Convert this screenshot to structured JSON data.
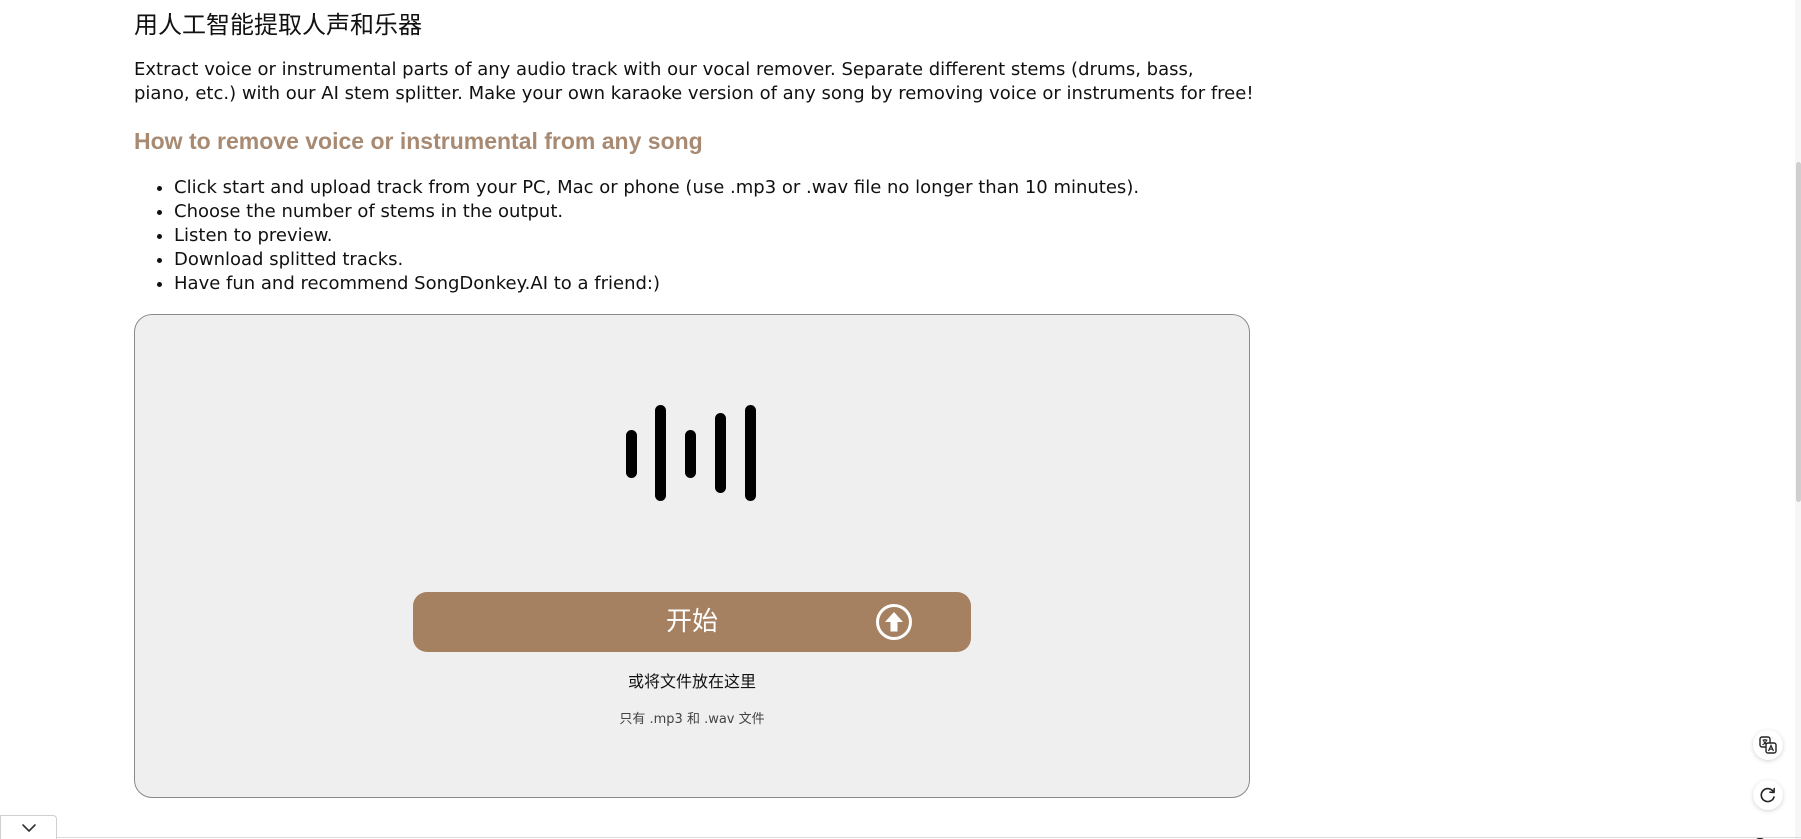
{
  "page": {
    "title": "用人工智能提取人声和乐器",
    "intro": "Extract voice or instrumental parts of any audio track with our vocal remover. Separate different stems (drums, bass, piano, etc.) with our AI stem splitter. Make your own karaoke version of any song by removing voice or instruments for free!",
    "how_to_heading": "How to remove voice or instrumental from any song",
    "steps": [
      "Click start and upload track from your PC, Mac or phone (use .mp3 or .wav file no longer than 10 minutes).",
      "Choose the number of stems in the output.",
      "Listen to preview.",
      "Download splitted tracks.",
      "Have fun and recommend SongDonkey.AI to a friend:)"
    ]
  },
  "uploader": {
    "icon": "audio-waveform-icon",
    "start_label": "开始",
    "start_icon": "upload-arrow-icon",
    "drop_hint": "或将文件放在这里",
    "format_hint": "只有 .mp3 和 .wav 文件"
  },
  "side_tools": [
    "translate-icon",
    "refresh-icon"
  ],
  "bottom_tab": {
    "icon": "chevron-down-icon"
  },
  "colors": {
    "accent": "#a58161",
    "heading": "#a88a72",
    "dropzone_bg": "#efefef"
  }
}
